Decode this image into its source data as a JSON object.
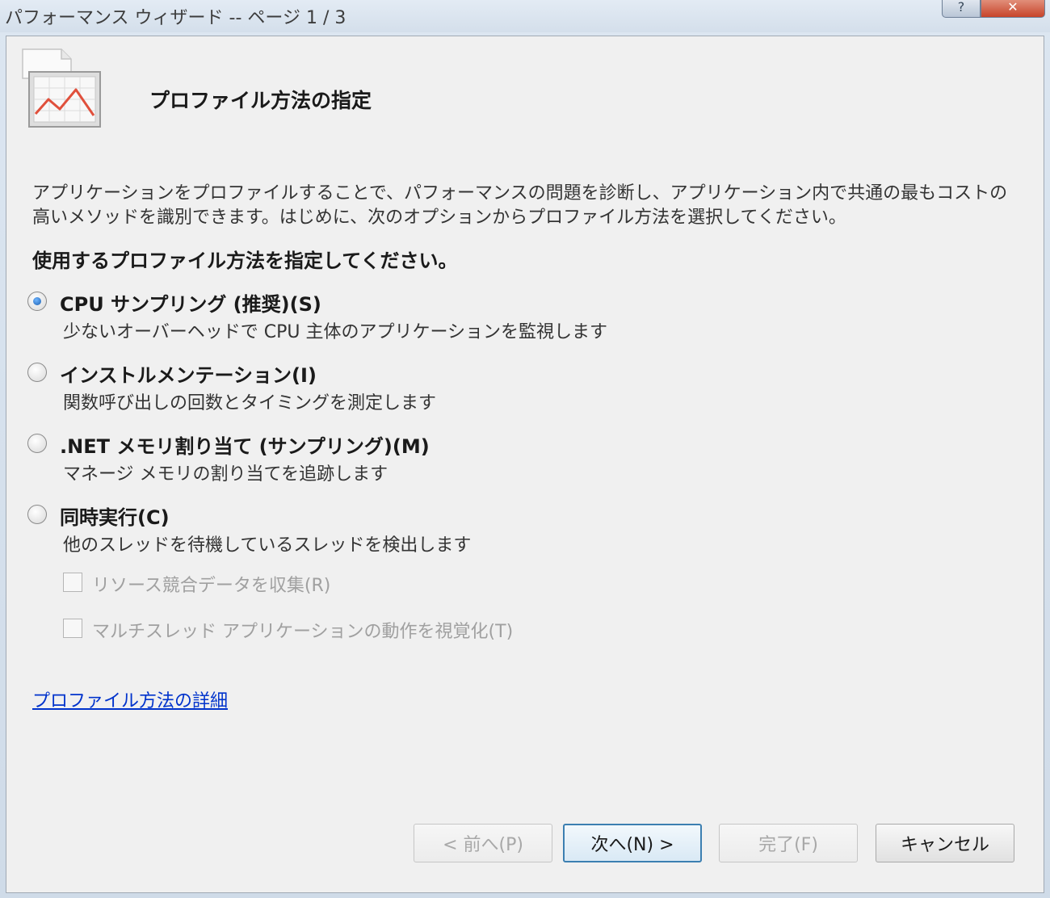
{
  "window": {
    "title": "パフォーマンス ウィザード -- ページ 1 / 3",
    "help_icon": "help-icon",
    "close_icon": "close-icon",
    "close_glyph": "✕",
    "help_glyph": "?"
  },
  "header": {
    "icon": "performance-chart-icon",
    "title": "プロファイル方法の指定"
  },
  "description": "アプリケーションをプロファイルすることで、パフォーマンスの問題を診断し、アプリケーション内で共通の最もコストの高いメソッドを識別できます。はじめに、次のオプションからプロファイル方法を選択してください。",
  "prompt": "使用するプロファイル方法を指定してください。",
  "options": [
    {
      "label": "CPU サンプリング (推奨)(S)",
      "description": "少ないオーバーヘッドで CPU 主体のアプリケーションを監視します",
      "checked": true
    },
    {
      "label": "インストルメンテーション(I)",
      "description": "関数呼び出しの回数とタイミングを測定します",
      "checked": false
    },
    {
      "label": ".NET メモリ割り当て (サンプリング)(M)",
      "description": "マネージ メモリの割り当てを追跡します",
      "checked": false
    },
    {
      "label": "同時実行(C)",
      "description": "他のスレッドを待機しているスレッドを検出します",
      "checked": false
    }
  ],
  "sub_options": [
    {
      "label": "リソース競合データを収集(R)",
      "checked": false,
      "enabled": false
    },
    {
      "label": "マルチスレッド アプリケーションの動作を視覚化(T)",
      "checked": false,
      "enabled": false
    }
  ],
  "link": "プロファイル方法の詳細",
  "buttons": {
    "back": "< 前へ(P)",
    "next": "次へ(N) >",
    "finish": "完了(F)",
    "cancel": "キャンセル"
  },
  "colors": {
    "link": "#0033cc",
    "chart_line": "#e0503c",
    "dialog_bg": "#f0f0f0"
  }
}
